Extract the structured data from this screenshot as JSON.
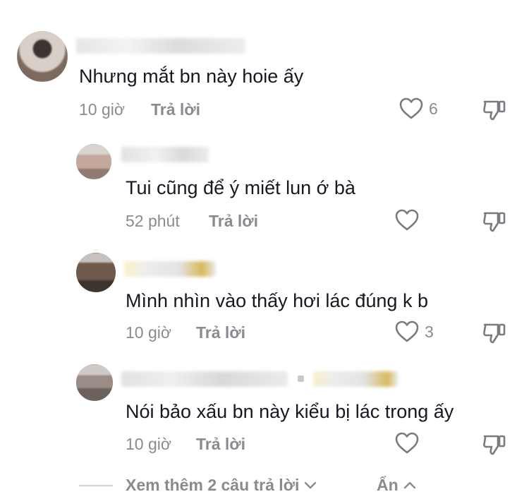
{
  "comments": [
    {
      "text": "Nhưng mắt bn này hoie ấy",
      "time": "10 giờ",
      "reply_label": "Trả lời",
      "likes": "6"
    },
    {
      "text": "Tui cũng để ý miết lun ớ bà",
      "time": "52 phút",
      "reply_label": "Trả lời",
      "likes": ""
    },
    {
      "text": "Mình nhìn vào thấy hơi lác đúng k b",
      "time": "10 giờ",
      "reply_label": "Trả lời",
      "likes": "3"
    },
    {
      "text": "Nói bảo xấu bn này kiểu bị lác trong ấy",
      "time": "10 giờ",
      "reply_label": "Trả lời",
      "likes": ""
    }
  ],
  "footer": {
    "view_more": "Xem thêm 2 câu trả lời",
    "hide": "Ẩn"
  },
  "icons": {
    "like": "heart-outline-icon",
    "dislike": "thumbs-down-icon",
    "expand": "chevron-down-icon",
    "collapse": "chevron-up-icon"
  },
  "colors": {
    "text": "#161823",
    "meta": "#8a8b91"
  }
}
